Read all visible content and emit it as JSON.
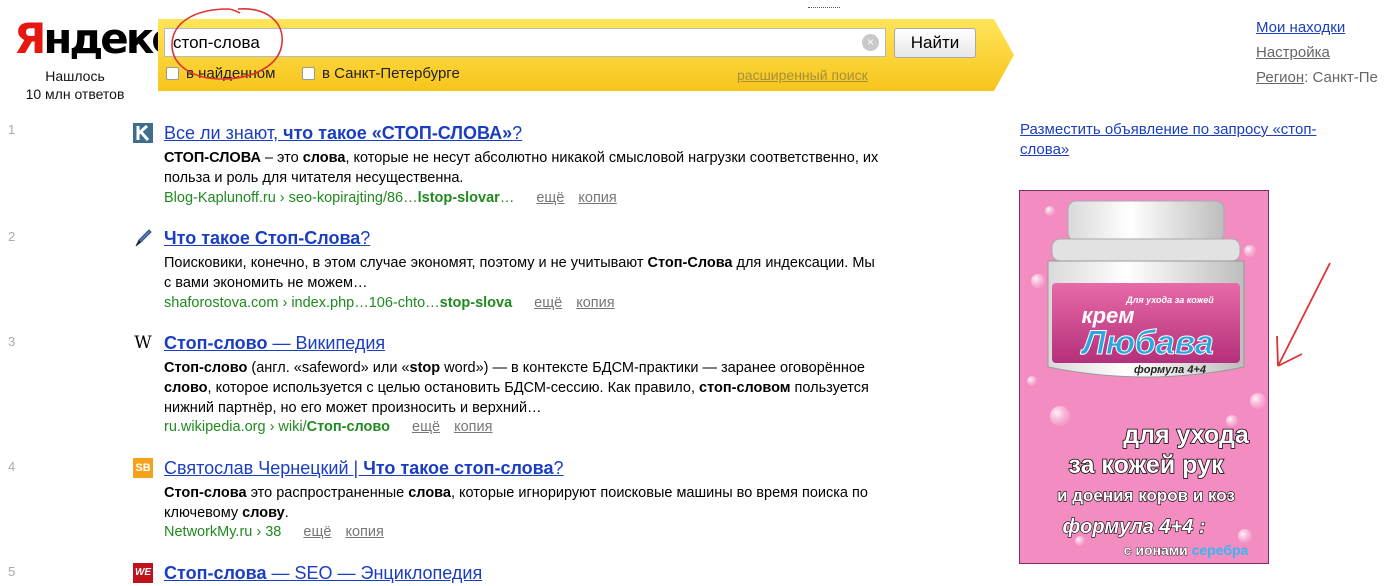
{
  "logo": {
    "first": "Я",
    "rest": "ндекс"
  },
  "found": {
    "line1": "Нашлось",
    "line2": "10 млн ответов"
  },
  "search": {
    "value": "стоп-слова",
    "clear": "×",
    "button": "Найти",
    "opt1": "в найденном",
    "opt2": "в Санкт-Петербурге",
    "advanced": "расширенный поиск"
  },
  "right_links": {
    "my_finds": "Мои находки",
    "settings": "Настройка",
    "region_label": "Регион",
    "region_value": ": Санкт-Пе"
  },
  "results": [
    {
      "num": "1",
      "favicon": "k-icon",
      "title_pre": "Все ли знают, ",
      "title_bold": "что такое «СТОП-СЛОВА»",
      "title_post": "?",
      "snippet_html": "<b>СТОП-СЛОВА</b> – это <b>слова</b>, которые не несут абсолютно никакой смысловой нагрузки соответственно, их польза и роль для читателя несущественна.",
      "url": "Blog-Kaplunoff.ru › seo-kopirajting/86…",
      "url_bold": "lstop-slovar",
      "url_post": "…",
      "more": "ещё",
      "copy": "копия"
    },
    {
      "num": "2",
      "favicon": "pen-icon",
      "title_pre": "",
      "title_bold": "Что такое Стоп-Слова",
      "title_post": "?",
      "snippet_html": "Поисковики, конечно, в этом случае экономят, поэтому и не учитывают <b>Стоп-Слова</b> для индексации. Мы с вами экономить не можем…",
      "url": "shaforostova.com › index.php…106-chto…",
      "url_bold": "stop-slova",
      "url_post": "",
      "more": "ещё",
      "copy": "копия"
    },
    {
      "num": "3",
      "favicon": "wikipedia-icon",
      "title_pre": "",
      "title_bold": "Стоп-слово",
      "title_post": " — Википедия",
      "snippet_html": "<b>Стоп-слово</b> (англ. «safeword» или «<b>stop</b> word») — в контексте БДСМ-практики — заранее оговорённое <b>слово</b>, которое используется с целью остановить БДСМ-сессию. Как правило, <b>стоп-словом</b> пользуется нижний партнёр, но его может произносить и верхний…",
      "url": "ru.wikipedia.org › wiki/",
      "url_bold": "Стоп-слово",
      "url_post": "",
      "more": "ещё",
      "copy": "копия"
    },
    {
      "num": "4",
      "favicon": "sb-icon",
      "title_pre": "Святослав Чернецкий | ",
      "title_bold": "Что такое стоп-слова",
      "title_post": "?",
      "snippet_html": "<b>Стоп-слова</b> это распространенные <b>слова</b>, которые игнорируют поисковые машины во время поиска по ключевому <b>слову</b>.",
      "url": "NetworkMy.ru › 38",
      "url_bold": "",
      "url_post": "",
      "more": "ещё",
      "copy": "копия"
    },
    {
      "num": "5",
      "favicon": "we-icon",
      "title_pre": "",
      "title_bold": "Стоп-слова",
      "title_post": " — SEO — Энциклопедия",
      "snippet_html": "",
      "url": "",
      "url_bold": "",
      "url_post": "",
      "more": "",
      "copy": ""
    }
  ],
  "ad": {
    "link": "Разместить объявление по запросу «стоп-слова»",
    "jar_small": "Для ухода за кожей",
    "jar_brand1": "крем",
    "jar_brand2": "Любава",
    "jar_formula": "формула 4+4",
    "line1": "для ухода",
    "line2": "за кожей рук",
    "line3": "и доения коров и коз",
    "line4": "формула 4+4 :",
    "line5a": "с ионами ",
    "line5b": "серебра"
  }
}
